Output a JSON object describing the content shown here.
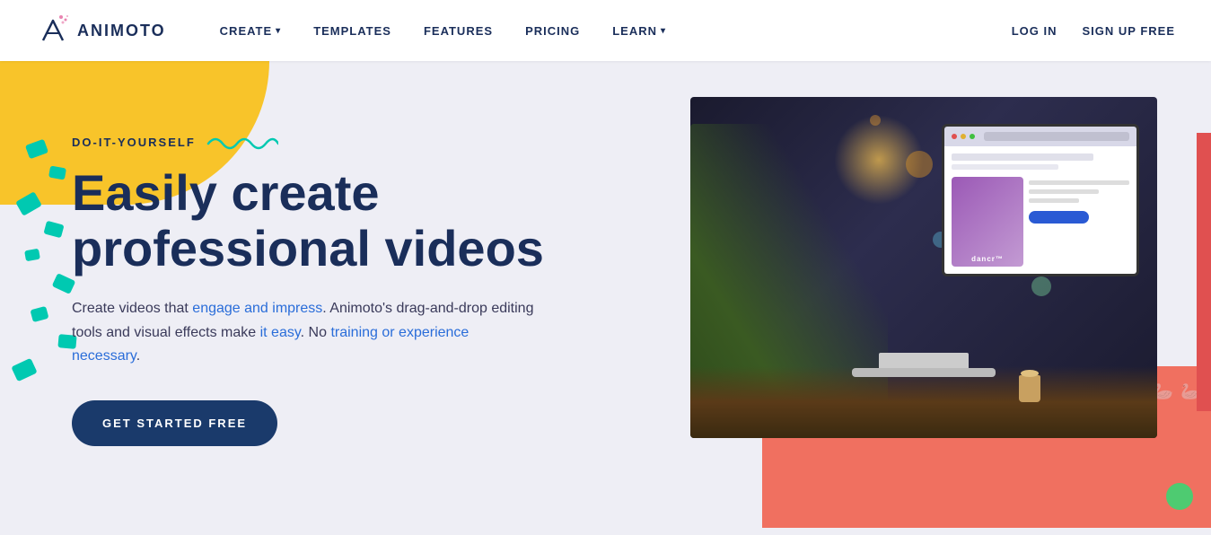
{
  "brand": {
    "name": "ANIMOTO",
    "logo_alt": "Animoto logo"
  },
  "navbar": {
    "links": [
      {
        "id": "create",
        "label": "CREATE",
        "has_dropdown": true
      },
      {
        "id": "templates",
        "label": "TEMPLATES",
        "has_dropdown": false
      },
      {
        "id": "features",
        "label": "FEATURES",
        "has_dropdown": false
      },
      {
        "id": "pricing",
        "label": "PRICING",
        "has_dropdown": false
      },
      {
        "id": "learn",
        "label": "LEARN",
        "has_dropdown": true
      }
    ],
    "login_label": "LOG IN",
    "signup_label": "SIGN UP FREE"
  },
  "hero": {
    "diy_label": "DO-IT-YOURSELF",
    "title_line1": "Easily create",
    "title_line2": "professional videos",
    "description": "Create videos that engage and impress. Animoto's drag-and-drop editing tools and visual effects make it easy. No training or experience necessary.",
    "cta_label": "GET STARTED FREE"
  },
  "colors": {
    "navy": "#1a2e5a",
    "teal": "#00c9b1",
    "yellow": "#f8c42a",
    "coral": "#f07060",
    "cta_bg": "#1a3a6b",
    "highlight_blue": "#2a6dd9"
  }
}
